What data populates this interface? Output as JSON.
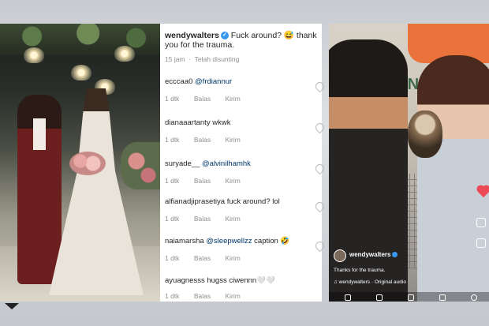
{
  "post": {
    "username": "wendywalters",
    "verified_mark": "✓",
    "caption": "Fuck around? 😅 thank you for the trauma.",
    "time": "15 jam",
    "edited": "Telah disunting"
  },
  "comments": [
    {
      "user": "ecccaa0",
      "mention": "@frdiannur",
      "text": "",
      "time": "1 dtk",
      "reply": "Balas",
      "send": "Kirim"
    },
    {
      "user": "dianaaartanty",
      "mention": "",
      "text": "wkwk",
      "time": "1 dtk",
      "reply": "Balas",
      "send": "Kirim"
    },
    {
      "user": "suryade__",
      "mention": "@alvinilhamhk",
      "text": "",
      "time": "1 dtk",
      "reply": "Balas",
      "send": "Kirim"
    },
    {
      "user": "alfianadjiprasetiya",
      "mention": "",
      "text": "fuck around? lol",
      "time": "1 dtk",
      "reply": "Balas",
      "send": "Kirim"
    },
    {
      "user": "naiamarsha",
      "mention": "@sleepwellzz",
      "text": "caption 🤣",
      "time": "1 dtk",
      "reply": "Balas",
      "send": "Kirim"
    },
    {
      "user": "ayuagnesss",
      "mention": "",
      "text": "hugss ciwennn🤍🤍",
      "time": "1 dtk",
      "reply": "Balas",
      "send": "Kirim"
    }
  ],
  "video": {
    "sign_text": "E'ON",
    "username": "wendywalters",
    "caption": "Thanks for the trauma.",
    "audio": "♫ wendywalters · Original audio"
  },
  "colors": {
    "verified": "#3897f0",
    "mention": "#00376b",
    "muted": "#8e8e8e",
    "like": "#ed4956"
  },
  "icons": [
    "verified-icon",
    "heart-icon",
    "send-icon",
    "share-icon",
    "music-icon"
  ]
}
